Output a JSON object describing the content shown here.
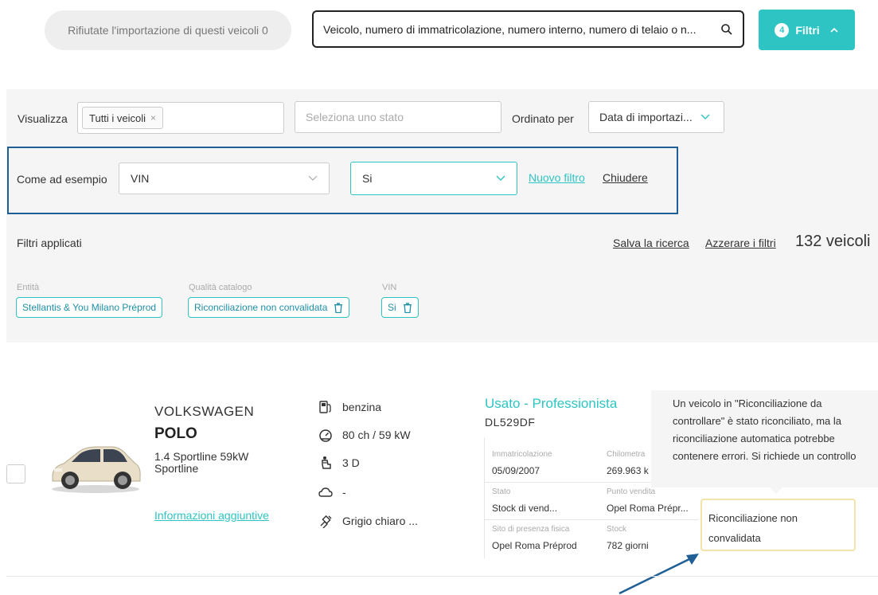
{
  "topbar": {
    "reject_label": "Rifiutate l'importazione di questi veicoli 0",
    "search_value": "Veicolo, numero di immatricolazione, numero interno, numero di telaio o n...",
    "filters_count": "4",
    "filters_label": "Filtri",
    "accent_color": "#2ec4c4"
  },
  "filters": {
    "view_label": "Visualizza",
    "view_chip": "Tutti i veicoli",
    "view_chip_remove": "×",
    "state_placeholder": "Seleziona uno stato",
    "order_label": "Ordinato per",
    "order_value": "Data di importazi...",
    "example_label": "Come ad esempio",
    "example_field": "VIN",
    "example_value": "Si",
    "new_filter": "Nuovo filtro",
    "close": "Chiudere",
    "applied_label": "Filtri applicati",
    "save_search": "Salva la ricerca",
    "reset_filters": "Azzerare i filtri",
    "vehicle_count": "132 veicoli",
    "applied": [
      {
        "label": "Entità",
        "value": "Stellantis & You Milano Préprod"
      },
      {
        "label": "Qualità catalogo",
        "value": "Riconciliazione non convalidata"
      },
      {
        "label": "VIN",
        "value": "Si"
      }
    ]
  },
  "vehicle": {
    "brand": "VOLKSWAGEN",
    "model": "POLO",
    "version_line1": "1.4 Sportline 59kW",
    "version_line2": "Sportline",
    "more_info": "Informazioni aggiuntive",
    "specs": {
      "fuel": "benzina",
      "power": "80 ch / 59 kW",
      "doors": "3 D",
      "emissions": "-",
      "color": "Grigio chiaro ..."
    },
    "usage": "Usato - Professionista",
    "plate": "DL529DF",
    "details": {
      "reg_label": "Immatricolazione",
      "reg_value": "05/09/2007",
      "km_label": "Chilometra",
      "km_value": "269.963 k",
      "status_label": "Stato",
      "status_value": "Stock di vend...",
      "sale_label": "Punto vendita",
      "sale_value": "Opel Roma Prépr...",
      "site_label": "Sito di presenza fisica",
      "site_value": "Opel Roma Préprod",
      "stock_label": "Stock",
      "stock_value": "782 giorni"
    },
    "tooltip": {
      "line1": "Un veicolo in \"Riconciliazione da",
      "line2": "controllare\" è stato riconciliato, ma la",
      "line3": "riconciliazione automatica potrebbe",
      "line4": "contenere errori. Si richiede un controllo"
    },
    "badge": {
      "line1": "Riconciliazione non",
      "line2": "convalidata"
    }
  }
}
